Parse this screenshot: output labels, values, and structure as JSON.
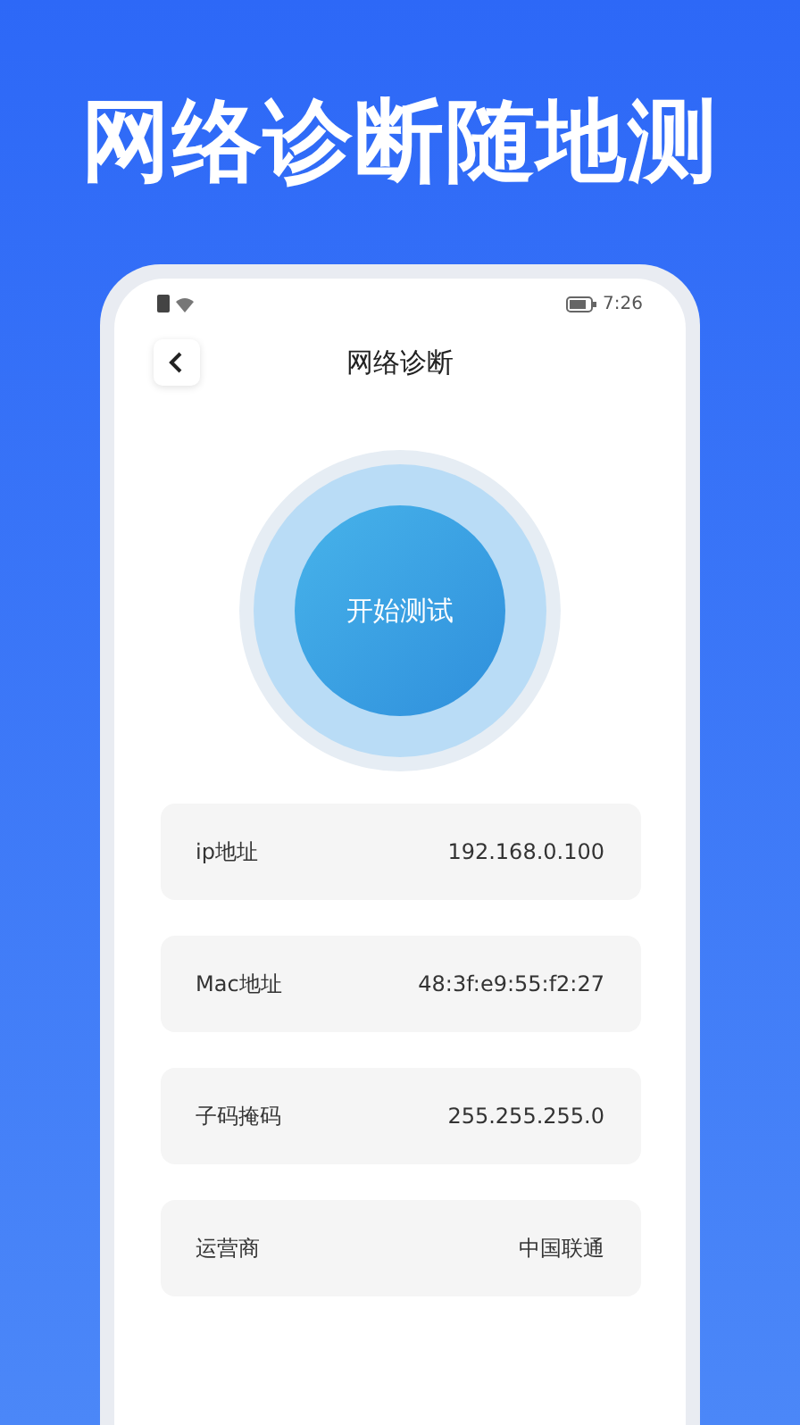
{
  "headline": "网络诊断随地测",
  "status_bar": {
    "time": "7:26"
  },
  "nav": {
    "title": "网络诊断"
  },
  "test_button": {
    "label": "开始测试"
  },
  "info_rows": [
    {
      "label": "ip地址",
      "value": "192.168.0.100"
    },
    {
      "label": "Mac地址",
      "value": "48:3f:e9:55:f2:27"
    },
    {
      "label": "子码掩码",
      "value": "255.255.255.0"
    },
    {
      "label": "运营商",
      "value": "中国联通"
    }
  ]
}
